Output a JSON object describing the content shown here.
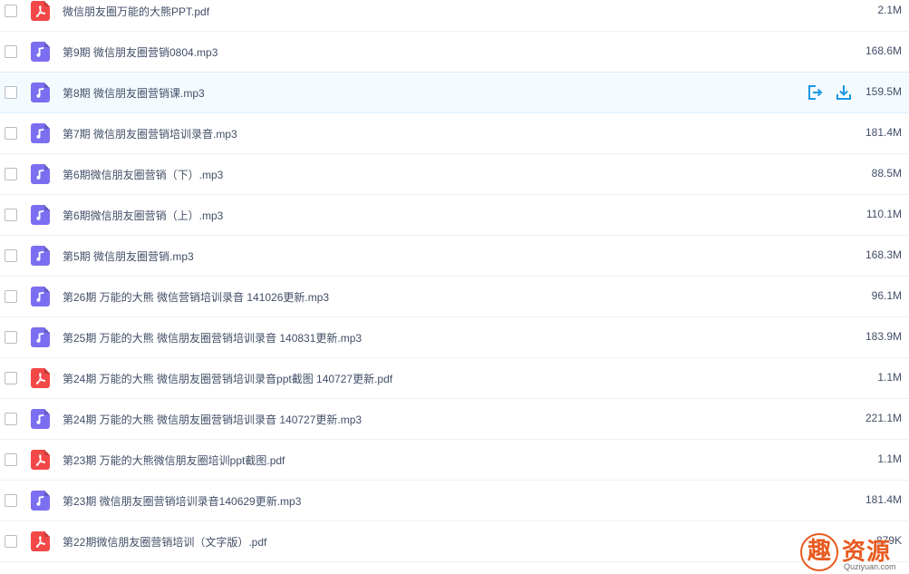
{
  "files": [
    {
      "name": "微信朋友圈万能的大熊PPT.pdf",
      "size": "2.1M",
      "type": "pdf",
      "icon": "pdf-icon"
    },
    {
      "name": "第9期 微信朋友圈营销0804.mp3",
      "size": "168.6M",
      "type": "mp3",
      "icon": "music-icon"
    },
    {
      "name": "第8期 微信朋友圈营销课.mp3",
      "size": "159.5M",
      "type": "mp3",
      "icon": "music-icon",
      "hovered": true
    },
    {
      "name": "第7期 微信朋友圈营销培训录音.mp3",
      "size": "181.4M",
      "type": "mp3",
      "icon": "music-icon"
    },
    {
      "name": "第6期微信朋友圈营销（下）.mp3",
      "size": "88.5M",
      "type": "mp3",
      "icon": "music-icon"
    },
    {
      "name": "第6期微信朋友圈营销（上）.mp3",
      "size": "110.1M",
      "type": "mp3",
      "icon": "music-icon"
    },
    {
      "name": "第5期 微信朋友圈营销.mp3",
      "size": "168.3M",
      "type": "mp3",
      "icon": "music-icon"
    },
    {
      "name": "第26期 万能的大熊 微信营销培训录音 141026更新.mp3",
      "size": "96.1M",
      "type": "mp3",
      "icon": "music-icon"
    },
    {
      "name": "第25期 万能的大熊 微信朋友圈营销培训录音 140831更新.mp3",
      "size": "183.9M",
      "type": "mp3",
      "icon": "music-icon"
    },
    {
      "name": "第24期 万能的大熊 微信朋友圈营销培训录音ppt截图 140727更新.pdf",
      "size": "1.1M",
      "type": "pdf",
      "icon": "pdf-icon"
    },
    {
      "name": "第24期 万能的大熊 微信朋友圈营销培训录音 140727更新.mp3",
      "size": "221.1M",
      "type": "mp3",
      "icon": "music-icon"
    },
    {
      "name": "第23期 万能的大熊微信朋友圈培训ppt截图.pdf",
      "size": "1.1M",
      "type": "pdf",
      "icon": "pdf-icon"
    },
    {
      "name": "第23期 微信朋友圈营销培训录音140629更新.mp3",
      "size": "181.4M",
      "type": "mp3",
      "icon": "music-icon"
    },
    {
      "name": "第22期微信朋友圈营销培训（文字版）.pdf",
      "size": "879K",
      "type": "pdf",
      "icon": "pdf-icon"
    }
  ],
  "row_actions": {
    "share_icon": "share-icon",
    "download_icon": "download-icon"
  },
  "colors": {
    "mp3_icon": "#7c6ef0",
    "pdf_icon": "#f24848",
    "action_blue": "#1a98e6",
    "text": "#424e67",
    "watermark": "#e85a1f"
  },
  "watermark": {
    "mark": "趣",
    "title": "资源",
    "subtitle": "Quziyuan.com"
  }
}
